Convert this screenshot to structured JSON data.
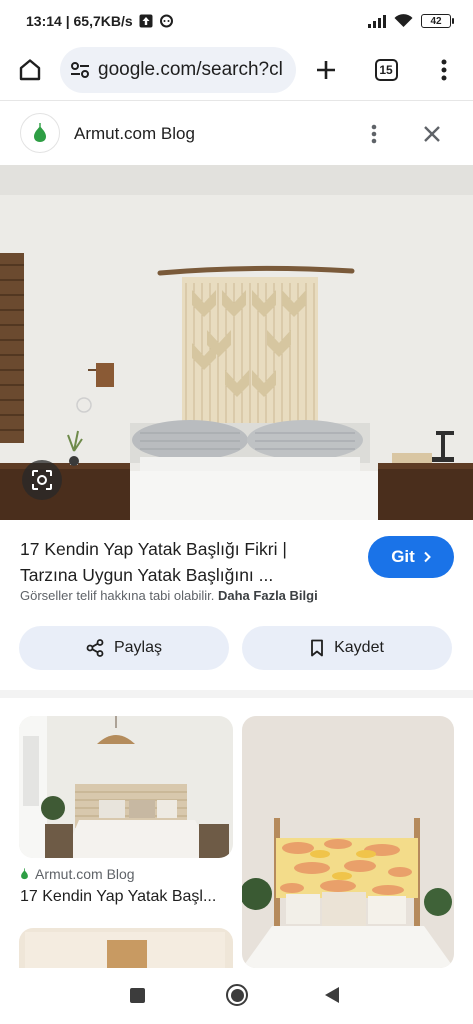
{
  "status_bar": {
    "time_speed": "13:14 | 65,7KB/s",
    "battery": "42"
  },
  "browser": {
    "url": "google.com/search?cl",
    "tab_count": "15"
  },
  "sheet": {
    "site_name": "Armut.com Blog"
  },
  "result": {
    "title_line1": "17 Kendin Yap Yatak Başlığı Fikri |",
    "title_line2": "Tarzına Uygun Yatak Başlığını ...",
    "visit_label": "Git",
    "copyright_text": "Görseller telif hakkına tabi olabilir.",
    "more_info_label": "Daha Fazla Bilgi",
    "share_label": "Paylaş",
    "save_label": "Kaydet"
  },
  "related": [
    {
      "source": "Armut.com Blog",
      "title": "17 Kendin Yap Yatak Başl..."
    }
  ],
  "colors": {
    "accent": "#1a73e8",
    "chip_bg": "#e9eef8",
    "favicon_green": "#2e9e44"
  },
  "icons": [
    "home-icon",
    "site-info-icon",
    "plus-icon",
    "tabs-icon",
    "more-vert-icon",
    "close-icon",
    "lens-icon",
    "chevron-right-icon",
    "share-icon",
    "bookmark-icon",
    "pear-icon"
  ]
}
